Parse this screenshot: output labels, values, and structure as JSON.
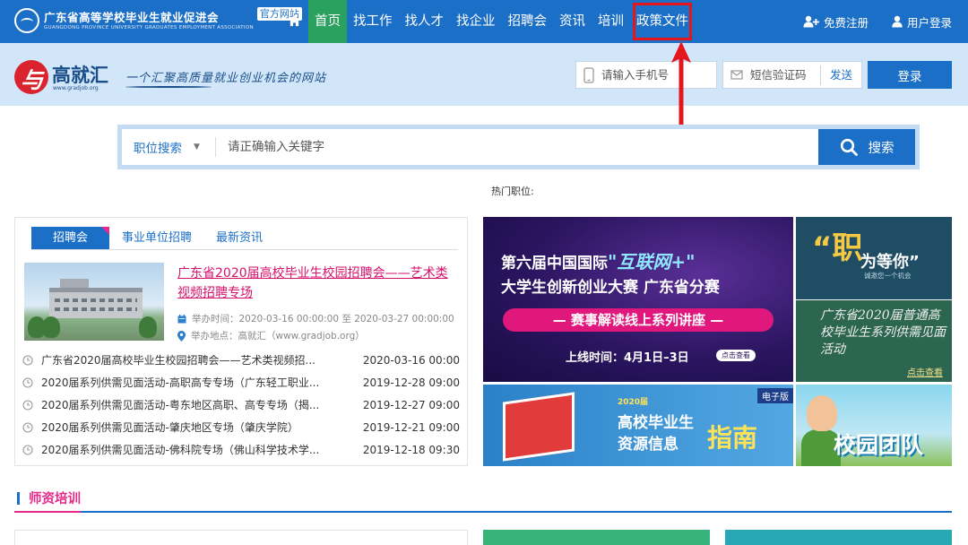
{
  "topbar": {
    "brand_name": "广东省高等学校毕业生就业促进会",
    "brand_en": "GUANGDONG PROVINCE UNIVERSITY GRADUATES EMPLOYMENT ASSOCIATION",
    "brand_tag": "官方网站",
    "nav": [
      {
        "label": "首页",
        "active": true
      },
      {
        "label": "找工作"
      },
      {
        "label": "找人才"
      },
      {
        "label": "找企业"
      },
      {
        "label": "招聘会"
      },
      {
        "label": "资讯"
      },
      {
        "label": "培训"
      },
      {
        "label": "政策文件",
        "highlighted": true
      }
    ],
    "register_label": "免费注册",
    "login_label": "用户登录"
  },
  "header": {
    "logo_char": "与",
    "logo_name": "高就汇",
    "logo_url": "www.gradjob.org",
    "slogan": "一个汇聚高质量就业创业机会的网站",
    "phone_placeholder": "请输入手机号",
    "code_placeholder": "短信验证码",
    "send_label": "发送",
    "login_button": "登录"
  },
  "search": {
    "category": "职位搜索",
    "placeholder": "请正确输入关键字",
    "button_label": "搜索",
    "hot_label": "热门职位:"
  },
  "panel": {
    "tabs": [
      "招聘会",
      "事业单位招聘",
      "最新资讯"
    ],
    "featured": {
      "title": "广东省2020届高校毕业生校园招聘会——艺术类视频招聘专场",
      "time_label": "举办时间：2020-03-16 00:00:00 至 2020-03-27 00:00:00",
      "place_label": "举办地点：高就汇（www.gradjob.org）"
    },
    "items": [
      {
        "title": "广东省2020届高校毕业生校园招聘会——艺术类视频招...",
        "date": "2020-03-16 00:00"
      },
      {
        "title": "2020届系列供需见面活动-高职高专专场（广东轻工职业...",
        "date": "2019-12-28 09:00"
      },
      {
        "title": "2020届系列供需见面活动-粤东地区高职、高专专场（揭...",
        "date": "2019-12-27 09:00"
      },
      {
        "title": "2020届系列供需见面活动-肇庆地区专场（肇庆学院）",
        "date": "2019-12-21 09:00"
      },
      {
        "title": "2020届系列供需见面活动-佛科院专场（佛山科学技术学...",
        "date": "2019-12-18 09:30"
      }
    ]
  },
  "banners": {
    "internet_plus": {
      "line1_pre": "第六届中国国际",
      "line1_hl": "\"互联网+\"",
      "line2": "大学生创新创业大赛 广东省分赛",
      "bar": "— 赛事解读线上系列讲座 —",
      "time": "上线时间：4月1日–3日",
      "pill": "点击查看"
    },
    "job_waiting": {
      "quote": "“职",
      "title": "为等你”",
      "sub": "诚邀您一个机会"
    },
    "meeting": {
      "title": "广东省2020届普通高校毕业生系列供需见面活动",
      "link": "点击查看"
    },
    "guide": {
      "tag": "电子版",
      "year": "2020届",
      "line1": "高校毕业生",
      "line2": "资源信息",
      "big": "指南"
    },
    "campus": {
      "title": "校园团队"
    }
  },
  "section": {
    "title": "师资培训"
  },
  "colors": {
    "primary": "#1c6fc6",
    "active_nav": "#2aa15f",
    "accent_pink": "#e6298a",
    "annotation_red": "#e3161d"
  }
}
